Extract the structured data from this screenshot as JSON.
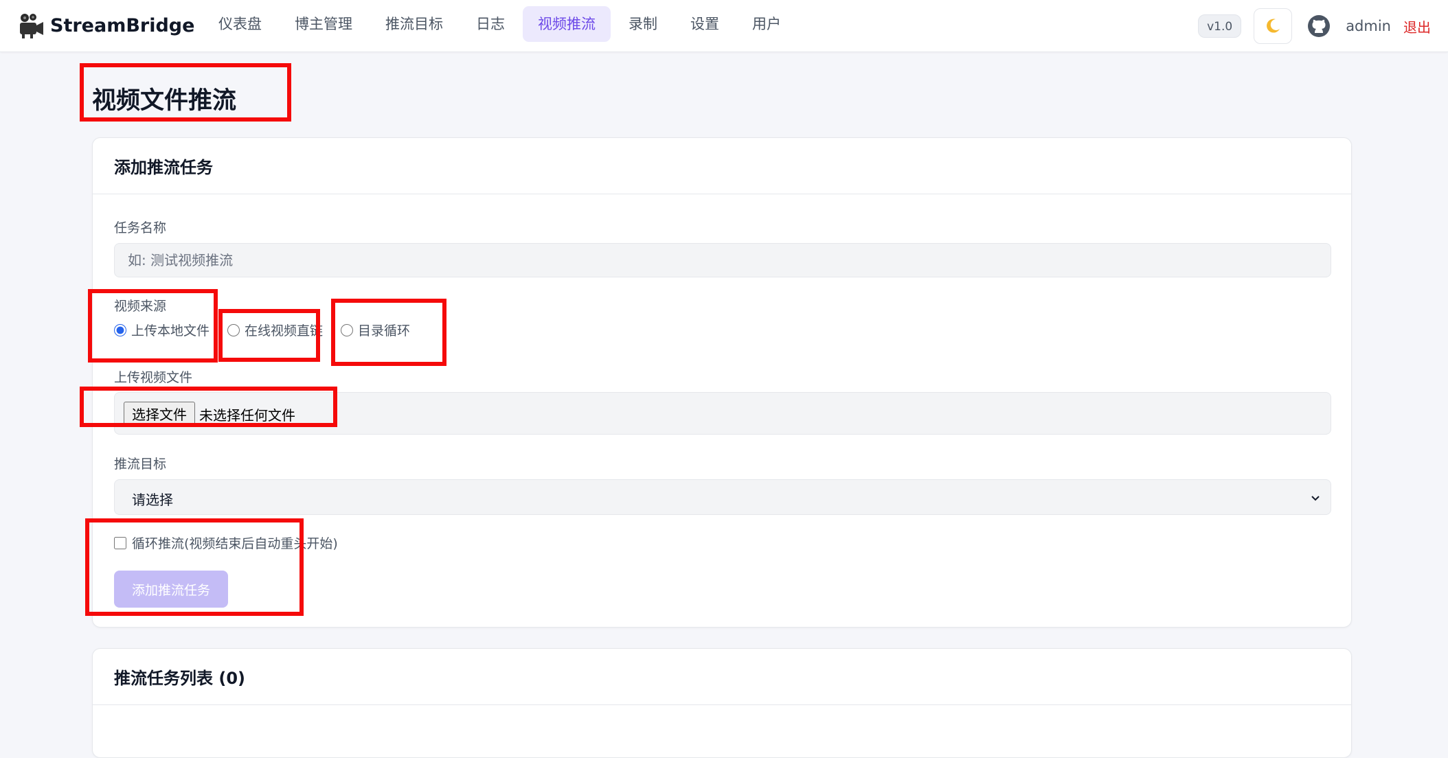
{
  "app": {
    "name": "StreamBridge",
    "version": "v1.0",
    "theme_icon": "moon-icon",
    "logo_icon": "camera-icon"
  },
  "nav": {
    "items": [
      {
        "label": "仪表盘"
      },
      {
        "label": "博主管理"
      },
      {
        "label": "推流目标"
      },
      {
        "label": "日志"
      },
      {
        "label": "视频推流",
        "active": true
      },
      {
        "label": "录制"
      },
      {
        "label": "设置"
      },
      {
        "label": "用户"
      }
    ]
  },
  "user": {
    "name": "admin",
    "logout_label": "退出"
  },
  "page": {
    "title": "视频文件推流"
  },
  "add_task": {
    "title": "添加推流任务",
    "task_name_label": "任务名称",
    "task_name_placeholder": "如: 测试视频推流",
    "source_label": "视频来源",
    "source_options": [
      {
        "label": "上传本地文件",
        "checked": true
      },
      {
        "label": "在线视频直链",
        "checked": false
      },
      {
        "label": "目录循环",
        "checked": false
      }
    ],
    "upload_label": "上传视频文件",
    "file_button_label": "选择文件",
    "file_status": "未选择任何文件",
    "target_label": "推流目标",
    "target_selected": "请选择",
    "loop_label": "循环推流(视频结束后自动重头开始)",
    "loop_checked": false,
    "submit_label": "添加推流任务"
  },
  "task_list": {
    "title": "推流任务列表 (0)"
  },
  "colors": {
    "accent": "#6d4ae8",
    "active_nav_bg": "#ece9fd",
    "logout": "#dc2626",
    "highlight": "#f50a0a",
    "submit_disabled": "#c4bcf6"
  }
}
